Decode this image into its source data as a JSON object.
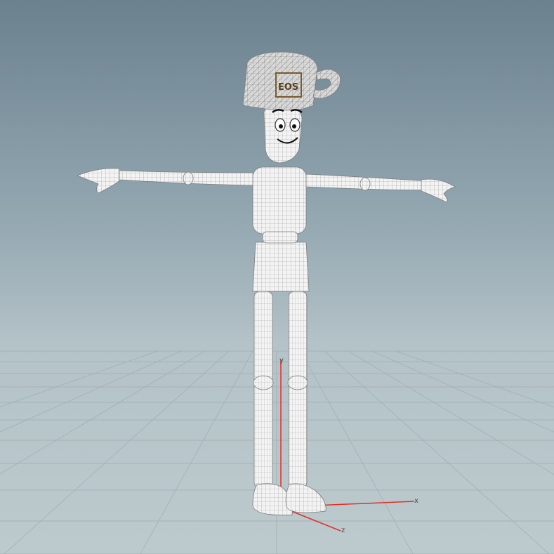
{
  "viewport": {
    "background_top": "#6b818e",
    "background_bottom": "#bccacd",
    "grid_color": "#9aa9ae"
  },
  "axes": {
    "y_label": "y",
    "x_label": "x",
    "z_label": "z",
    "y_color": "#e0302a",
    "x_color": "#e0302a",
    "z_color": "#e0302a"
  },
  "character": {
    "cap_logo": "EOS",
    "mesh_color": "#f2f2f2",
    "wire_color": "#8a8a8a",
    "logo_color": "#7a5a2a"
  }
}
